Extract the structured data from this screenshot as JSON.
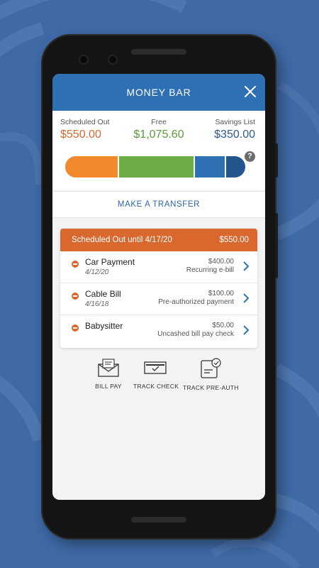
{
  "header": {
    "title": "MONEY BAR"
  },
  "summary": {
    "scheduled_out": {
      "label": "Scheduled Out",
      "amount": "$550.00",
      "color": "#d8682e"
    },
    "free": {
      "label": "Free",
      "amount": "$1,075.60",
      "color": "#5c9a3a"
    },
    "savings": {
      "label": "Savings List",
      "amount": "$350.00",
      "color": "#2c5a92"
    },
    "help_glyph": "?"
  },
  "money_bar": {
    "segments": [
      {
        "name": "scheduled-out",
        "fraction": 0.3,
        "color": "#f08a2c"
      },
      {
        "name": "free",
        "fraction": 0.42,
        "color": "#6dab45"
      },
      {
        "name": "savings",
        "fraction": 0.17,
        "color": "#2f6fb3"
      },
      {
        "name": "savings-remainder",
        "fraction": 0.11,
        "color": "#23558f"
      }
    ]
  },
  "transfer": {
    "label": "MAKE A TRANSFER"
  },
  "scheduled_card": {
    "title": "Scheduled Out until 4/17/20",
    "total": "$550.00",
    "items": [
      {
        "name": "Car Payment",
        "date": "4/12/20",
        "amount": "$400.00",
        "type": "Recurring e-bill"
      },
      {
        "name": "Cable Bill",
        "date": "4/16/18",
        "amount": "$100.00",
        "type": "Pre-authorized payment"
      },
      {
        "name": "Babysitter",
        "date": "",
        "amount": "$50.00",
        "type": "Uncashed bill pay check"
      }
    ]
  },
  "actions": [
    {
      "label": "BILL PAY",
      "icon": "envelope-icon"
    },
    {
      "label": "TRACK CHECK",
      "icon": "check-icon"
    },
    {
      "label": "TRACK PRE-AUTH",
      "icon": "document-check-icon"
    }
  ]
}
